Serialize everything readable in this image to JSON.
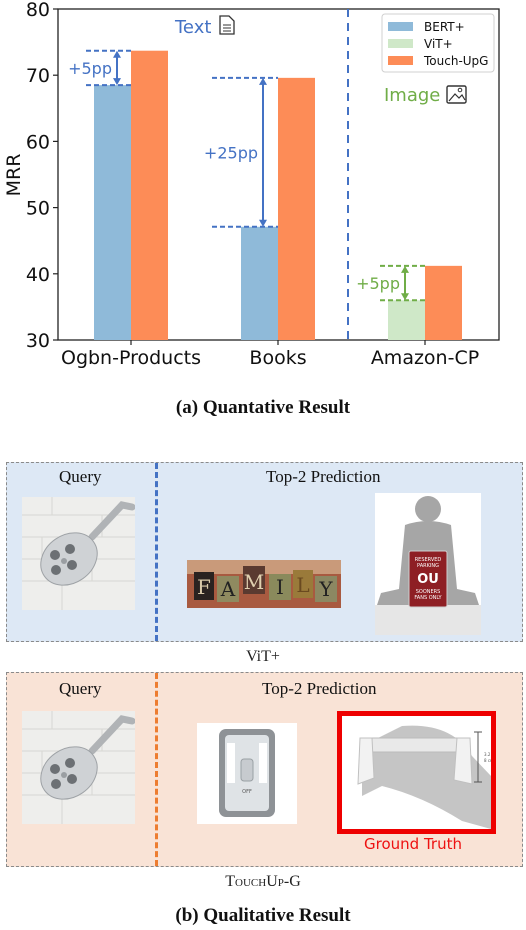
{
  "chart_data": {
    "type": "bar",
    "title": "",
    "xlabel": "",
    "ylabel": "MRR",
    "ylim": [
      30,
      80
    ],
    "yticks": [
      30,
      40,
      50,
      60,
      70,
      80
    ],
    "categories": [
      "Ogbn-Products",
      "Books",
      "Amazon-CP"
    ],
    "series": [
      {
        "name": "BERT+",
        "color": "#8fbad9",
        "values": [
          68.5,
          47.1,
          null
        ]
      },
      {
        "name": "ViT+",
        "color": "#cfe8c8",
        "values": [
          null,
          null,
          36.0
        ]
      },
      {
        "name": "Touch-UpG",
        "color": "#fd8c57",
        "values": [
          73.7,
          69.6,
          41.2
        ]
      }
    ],
    "legend": {
      "placement": "top-right",
      "entries": [
        "BERT+",
        "ViT+",
        "Touch-UpG"
      ]
    },
    "grid": false,
    "annotations": [
      {
        "label": "+5pp",
        "category": "Ogbn-Products",
        "from": 68.5,
        "to": 73.7,
        "color": "#4472c4"
      },
      {
        "label": "+25pp",
        "category": "Books",
        "from": 47.1,
        "to": 69.6,
        "color": "#4472c4"
      },
      {
        "label": "+5pp",
        "category": "Amazon-CP",
        "from": 36.0,
        "to": 41.2,
        "color": "#70ad47"
      }
    ],
    "modality_labels": [
      {
        "text": "Text",
        "icon": "document-icon",
        "color": "#4472c4",
        "region": "Ogbn-Products, Books"
      },
      {
        "text": "Image",
        "icon": "image-icon",
        "color": "#70ad47",
        "region": "Amazon-CP"
      }
    ],
    "separator": {
      "between": [
        "Books",
        "Amazon-CP"
      ],
      "style": "dashed",
      "color": "#4472c4"
    }
  },
  "captions": {
    "a": "(a) Quantative Result",
    "b": "(b) Qualitative Result"
  },
  "qualitative": {
    "panels": [
      {
        "model": "ViT+",
        "query_title": "Query",
        "prediction_title": "Top-2 Prediction",
        "query_image": "shower-head",
        "predictions": [
          {
            "image": "family-letter-blocks",
            "text": "FAMILY"
          },
          {
            "image": "reserved-parking-sign",
            "text": "RESERVED PARKING OU SOONERS FANS ONLY"
          }
        ]
      },
      {
        "model_prefix": "Touch",
        "model_mid": "Up",
        "model_suffix": "-G",
        "query_title": "Query",
        "prediction_title": "Top-2 Prediction",
        "query_image": "shower-head",
        "predictions": [
          {
            "image": "led-light-switch",
            "text": "OFF"
          },
          {
            "image": "toilet-paper-holder",
            "text": "3.2 in 8 cm",
            "ground_truth": true
          }
        ],
        "ground_truth_label": "Ground Truth"
      }
    ]
  }
}
